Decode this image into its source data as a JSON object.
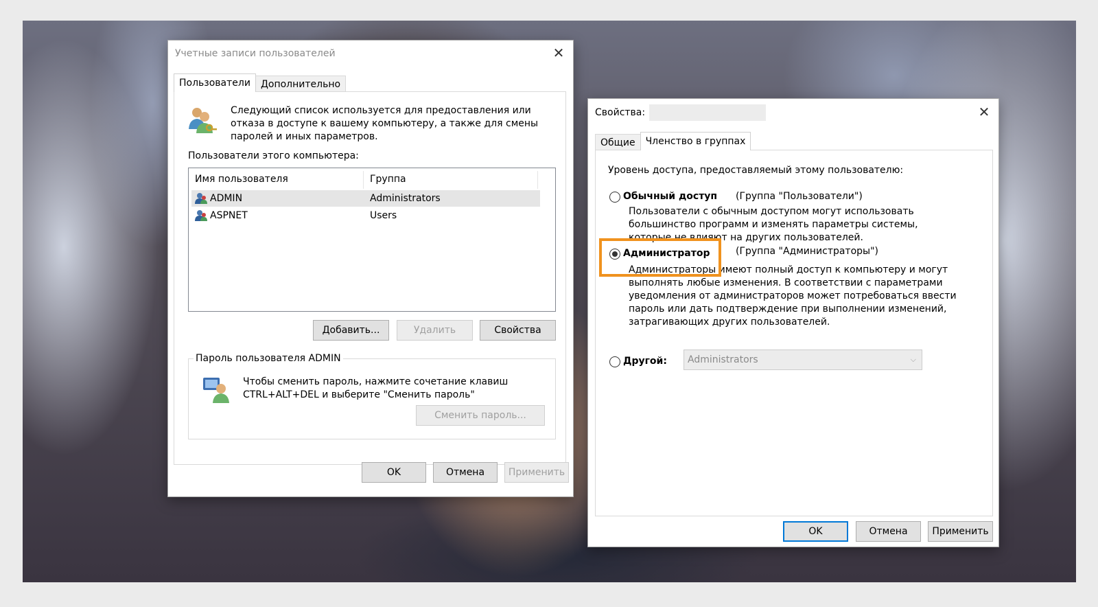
{
  "user_accounts": {
    "title": "Учетные записи пользователей",
    "tabs": [
      {
        "label": "Пользователи"
      },
      {
        "label": "Дополнительно"
      }
    ],
    "description": "Следующий список используется для предоставления или отказа в доступе к вашему компьютеру, а также для смены паролей и иных параметров.",
    "users_label": "Пользователи этого компьютера:",
    "columns": {
      "username": "Имя пользователя",
      "group": "Группа"
    },
    "rows": [
      {
        "name": "ADMIN",
        "group": "Administrators"
      },
      {
        "name": "ASPNET",
        "group": "Users"
      }
    ],
    "buttons": {
      "add": "Добавить...",
      "remove": "Удалить",
      "properties": "Свойства"
    },
    "password_group": {
      "title": "Пароль пользователя ADMIN",
      "text": "Чтобы сменить пароль, нажмите сочетание клавиш CTRL+ALT+DEL и выберите \"Сменить пароль\"",
      "button": "Сменить пароль..."
    },
    "footer": {
      "ok": "OK",
      "cancel": "Отмена",
      "apply": "Применить"
    },
    "icons": {
      "users": "users-group-icon",
      "user": "user-icon",
      "key": "user-key-icon"
    }
  },
  "properties": {
    "title": "Свойства:",
    "tabs": [
      {
        "label": "Общие"
      },
      {
        "label": "Членство в группах"
      }
    ],
    "access_label": "Уровень доступа, предоставляемый этому пользователю:",
    "options": {
      "standard": {
        "label": "Обычный доступ",
        "group": "(Группа \"Пользователи\")",
        "description": "Пользователи с обычным доступом могут использовать большинство программ и изменять параметры системы, которые не влияют на других пользователей."
      },
      "admin": {
        "label": "Администратор",
        "group": "(Группа \"Администраторы\")",
        "description": "Администраторы имеют полный доступ к компьютеру и могут выполнять любые изменения. В соответствии с параметрами уведомления от администраторов может потребоваться ввести пароль или дать подтверждение при выполнении изменений, затрагивающих других пользователей."
      },
      "other": {
        "label": "Другой:",
        "selected_value": "Administrators"
      }
    },
    "selected_option": "admin",
    "footer": {
      "ok": "OK",
      "cancel": "Отмена",
      "apply": "Применить"
    },
    "highlight_color": "#f0921e"
  },
  "colors": {
    "accent": "#0078d7",
    "disabled_text": "#a0a0a0"
  }
}
